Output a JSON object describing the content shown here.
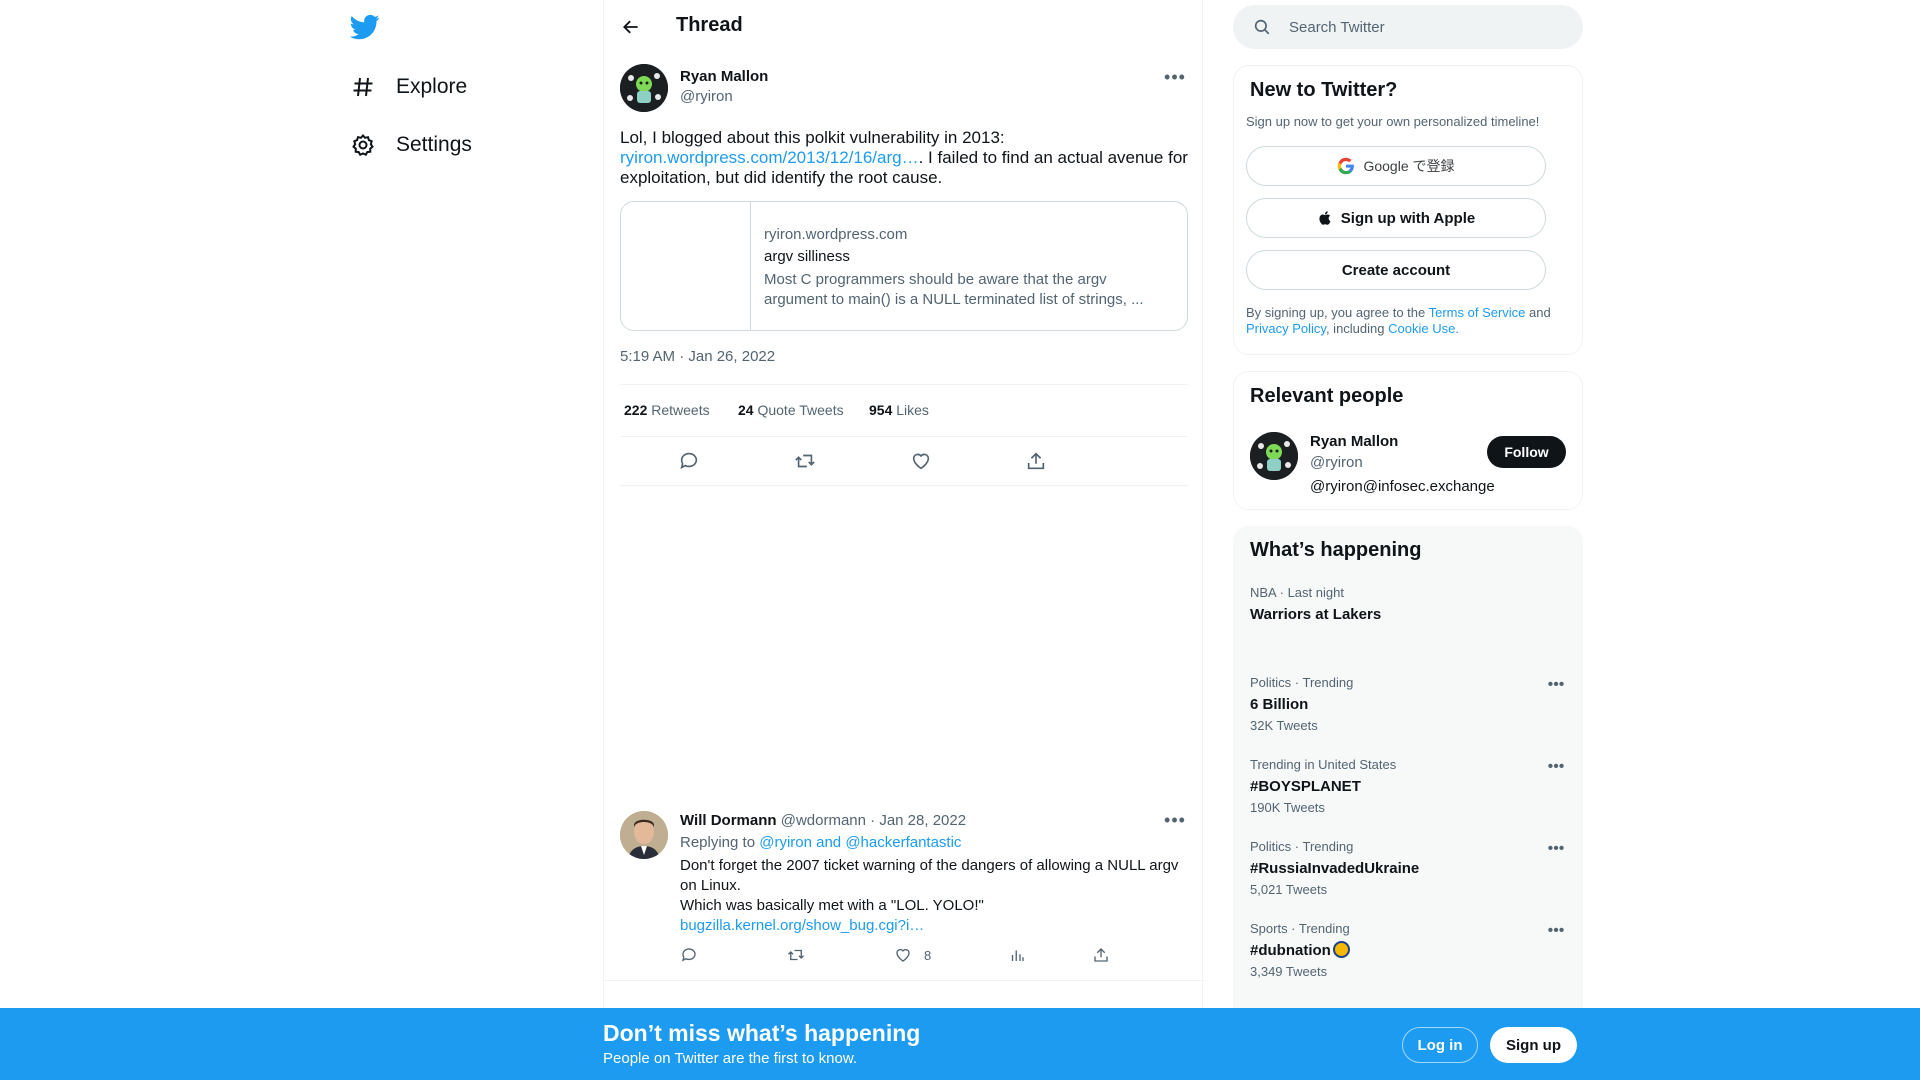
{
  "nav": {
    "logo": "twitter-bird-icon",
    "items": [
      {
        "label": "Explore",
        "icon": "hashtag-icon"
      },
      {
        "label": "Settings",
        "icon": "gear-icon"
      }
    ]
  },
  "header": {
    "title": "Thread"
  },
  "tweet": {
    "name": "Ryan Mallon",
    "handle": "@ryiron",
    "text_before": "Lol, I blogged about this polkit vulnerability in 2013: ",
    "link": "ryiron.wordpress.com/2013/12/16/arg…",
    "text_after": ". I failed to find an actual avenue for exploitation, but did identify the root cause.",
    "card": {
      "domain": "ryiron.wordpress.com",
      "title": "argv silliness",
      "description": "Most C programmers should be aware that the argv argument to main() is a NULL terminated list of strings, ..."
    },
    "time": "5:19 AM · Jan 26, 2022",
    "retweets": "222",
    "retweets_label": "Retweets",
    "quotes": "24",
    "quotes_label": "Quote Tweets",
    "likes": "954",
    "likes_label": "Likes"
  },
  "reply": {
    "name": "Will Dormann",
    "handle": "@wdormann",
    "date": "· Jan 28, 2022",
    "replying_prefix": "Replying to",
    "replying_to": "@ryiron and @hackerfantastic",
    "line1": "Don't forget the 2007 ticket warning of the dangers of allowing a NULL argv on Linux.",
    "line2": "Which was basically met with a \"LOL.  YOLO!\"",
    "link": "bugzilla.kernel.org/show_bug.cgi?i…",
    "likes": "8"
  },
  "search": {
    "placeholder": "Search Twitter"
  },
  "signup_panel": {
    "title": "New to Twitter?",
    "subtitle": "Sign up now to get your own personalized timeline!",
    "google": "Google で登録",
    "apple": "Sign up with Apple",
    "create": "Create account",
    "terms_1": "By signing up, you agree to the ",
    "terms_link1": "Terms of Service",
    "terms_2": " and ",
    "terms_link2": "Privacy Policy",
    "terms_3": ", including ",
    "terms_link3": "Cookie Use."
  },
  "people": {
    "title": "Relevant people",
    "name": "Ryan Mallon",
    "handle": "@ryiron",
    "bio": "@ryiron@infosec.exchange",
    "follow": "Follow"
  },
  "trends": {
    "title": "What’s happening",
    "items": [
      {
        "category": "NBA · Last night",
        "name": "Warriors at Lakers",
        "count": ""
      },
      {
        "category": "Politics · Trending",
        "name": "6 Billion",
        "count": "32K Tweets"
      },
      {
        "category": "Trending in United States",
        "name": "#BOYSPLANET",
        "count": "190K Tweets"
      },
      {
        "category": "Politics · Trending",
        "name": "#RussiaInvadedUkraine",
        "count": "5,021 Tweets"
      },
      {
        "category": "Sports · Trending",
        "name": "#dubnation",
        "count": "3,349 Tweets"
      }
    ]
  },
  "bottom": {
    "title": "Don’t miss what’s happening",
    "subtitle": "People on Twitter are the first to know.",
    "login": "Log in",
    "signup": "Sign up"
  },
  "colors": {
    "accent": "#1d9bf0",
    "text": "#0f1419",
    "muted": "#536471"
  }
}
